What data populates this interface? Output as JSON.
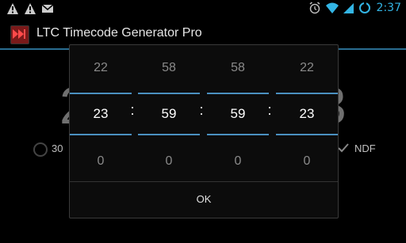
{
  "status_bar": {
    "time": "2:37",
    "colors": {
      "accent": "#33b5e5"
    }
  },
  "app": {
    "title": "LTC Timecode Generator Pro"
  },
  "background": {
    "left_digit": "2",
    "right_digit": "3",
    "radio_label": "30",
    "checkbox_label": "NDF"
  },
  "dialog": {
    "columns": [
      {
        "prev": "22",
        "current": "23",
        "next": "0"
      },
      {
        "prev": "58",
        "current": "59",
        "next": "0"
      },
      {
        "prev": "58",
        "current": "59",
        "next": "0"
      },
      {
        "prev": "22",
        "current": "23",
        "next": "0"
      }
    ],
    "separator": ":",
    "ok_label": "OK"
  }
}
